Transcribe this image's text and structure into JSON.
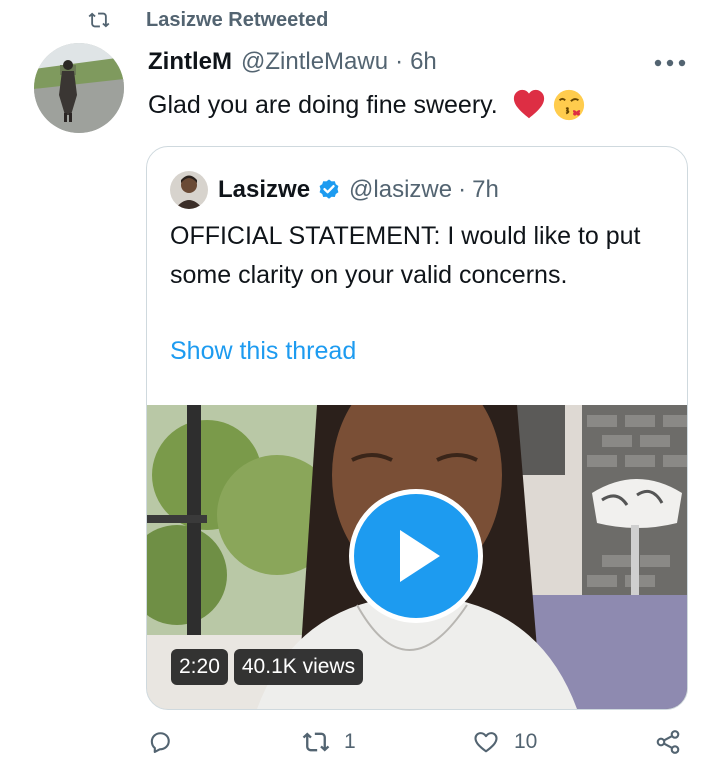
{
  "retweet_banner": {
    "text": "Lasizwe Retweeted",
    "icon": "retweet-icon"
  },
  "tweet": {
    "author_name": "ZintleM",
    "author_handle": "@ZintleMawu",
    "separator": "·",
    "time": "6h",
    "text": "Glad you are doing fine sweery.",
    "emojis": [
      "red-heart-emoji",
      "face-blowing-kiss-emoji"
    ],
    "more_icon": "more-dots-icon"
  },
  "quoted_tweet": {
    "author_name": "Lasizwe",
    "verified": true,
    "author_handle": "@lasizwe",
    "separator": "·",
    "time": "7h",
    "text": "OFFICIAL STATEMENT: I would like to put some clarity on your valid concerns.",
    "show_thread": "Show this thread",
    "video": {
      "duration": "2:20",
      "views": "40.1K views"
    }
  },
  "actions": {
    "reply_count": "",
    "retweet_count": "1",
    "like_count": "10"
  },
  "colors": {
    "accent": "#1d9bf0",
    "secondary_text": "#536471",
    "primary_text": "#0f1419",
    "border": "#cfd9de",
    "heart": "#e0245e"
  }
}
